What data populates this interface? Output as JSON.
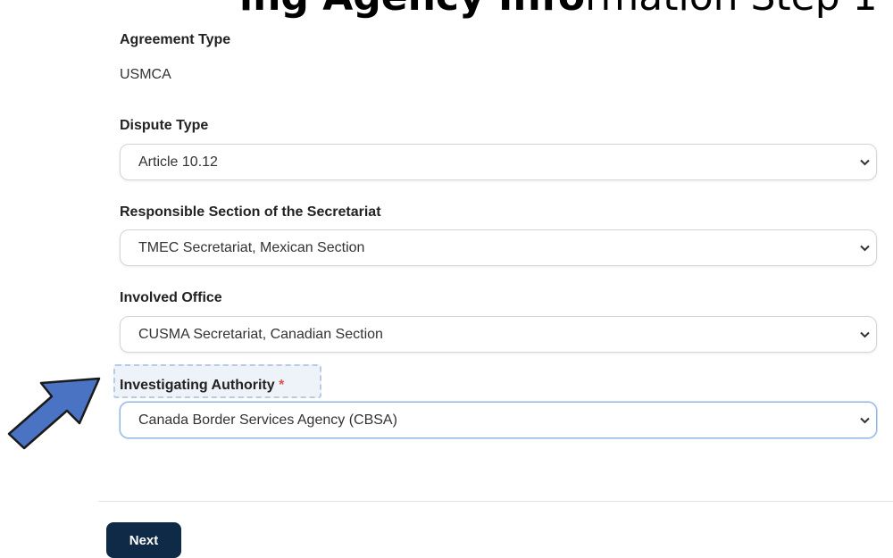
{
  "header": {
    "title_bold": "ing Agency Info",
    "title_light": "rmation Step 1"
  },
  "form": {
    "agreement_type": {
      "label": "Agreement Type",
      "value": "USMCA"
    },
    "dispute_type": {
      "label": "Dispute Type",
      "value": "Article 10.12"
    },
    "responsible_section": {
      "label": "Responsible Section of the Secretariat",
      "value": "TMEC Secretariat, Mexican Section"
    },
    "involved_office": {
      "label": "Involved Office",
      "value": "CUSMA Secretariat, Canadian Section"
    },
    "investigating_authority": {
      "label": "Investigating Authority",
      "required_marker": "*",
      "value": "Canada Border Services Agency (CBSA)"
    }
  },
  "actions": {
    "next_label": "Next"
  },
  "colors": {
    "button_bg": "#0f2a47",
    "required": "#d9534f",
    "arrow_fill": "#4a73c4",
    "highlight_bg": "#eef3fa"
  },
  "icons": {
    "dropdown": "chevron-down-icon",
    "pointer": "arrow-pointer-icon"
  }
}
